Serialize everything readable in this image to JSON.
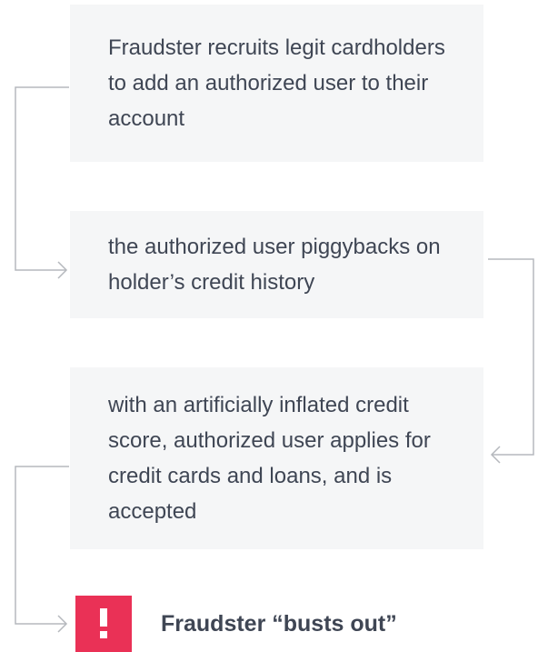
{
  "steps": [
    {
      "text": "Fraudster recruits legit cardholders to add an authorized user to their account"
    },
    {
      "text": "the authorized user piggybacks on holder’s credit history"
    },
    {
      "text": "with an artificially inflated credit score, authorized user applies for credit cards and loans, and is accepted"
    }
  ],
  "outcome": {
    "icon": "exclamation-icon",
    "label": "Fraudster “busts out”"
  },
  "colors": {
    "box_bg": "#f5f6f7",
    "text": "#3f4654",
    "connector": "#b5b8bd",
    "alert": "#ea3156"
  }
}
